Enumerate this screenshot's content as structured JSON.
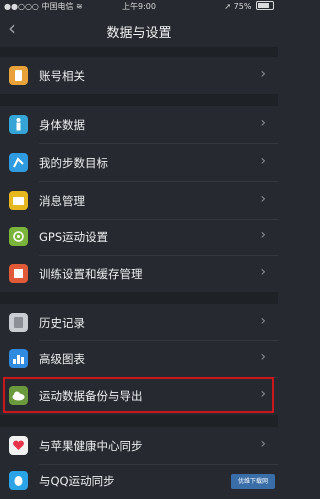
{
  "status_bar": {
    "carrier": "中国电信",
    "time": "上午9:00",
    "battery": "75%",
    "battery_level": 0.75
  },
  "nav": {
    "back_glyph": "‹",
    "title": "数据与设置"
  },
  "menu": [
    {
      "label": "账号相关",
      "icon": "account-icon",
      "color": "#e9a23a"
    },
    {
      "label": "身体数据",
      "icon": "body-icon",
      "color": "#35a5d8"
    },
    {
      "label": "我的步数目标",
      "icon": "steps-goal-icon",
      "color": "#2f9be0"
    },
    {
      "label": "消息管理",
      "icon": "message-icon",
      "color": "#e5b81f"
    },
    {
      "label": "GPS运动设置",
      "icon": "gps-icon",
      "color": "#7bb43a"
    },
    {
      "label": "训练设置和缓存管理",
      "icon": "training-icon",
      "color": "#e05a37"
    },
    {
      "label": "历史记录",
      "icon": "history-icon",
      "color": "#c9ccd1"
    },
    {
      "label": "高级图表",
      "icon": "chart-icon",
      "color": "#2f8ae0"
    },
    {
      "label": "运动数据备份与导出",
      "icon": "cloud-icon",
      "color": "#6a9a3b"
    },
    {
      "label": "与苹果健康中心同步",
      "icon": "health-heart-icon",
      "color": "#f2f2f2"
    },
    {
      "label": "与QQ运动同步",
      "icon": "qq-icon",
      "color": "#2aa4e6"
    }
  ],
  "chevron": "›",
  "watermark": "优维下载网"
}
